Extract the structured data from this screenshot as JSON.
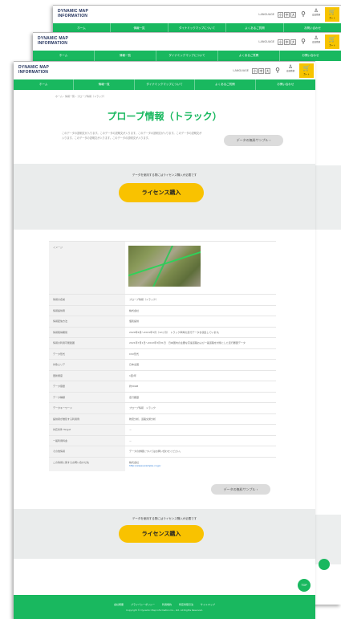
{
  "site": {
    "logo_line1": "DYNAMIC MAP",
    "logo_line2": "INFORMATION",
    "lang": "LANGUAGE",
    "font_sizes": [
      "小",
      "中",
      "大"
    ],
    "account_label": "会員登録",
    "cart_label": "カート",
    "nav": [
      "ホーム",
      "情報一覧",
      "ダイナミックマップについて",
      "よくあるご質問",
      "お問い合わせ"
    ]
  },
  "breadcrumb": "ホーム › 情報一覧 › プローブ情報（トラック）",
  "page_title": "プローブ情報（トラック）",
  "intro": "このデータの説明文が入ります。このデータの説明文が入ります。このデータの説明文が入ります。このデータの説明文が入ります。このデータの説明文が入ります。このデータの説明文が入ります。",
  "sample_button": "データの無料サンプル",
  "license": {
    "note": "データを使用する際にはライセンス購入が必要です",
    "button": "ライセンス購入"
  },
  "details": {
    "image_label": "イメージ",
    "rows": [
      {
        "k": "情報の名前",
        "v": "プローブ情報（トラック）"
      },
      {
        "k": "情報提供者",
        "v": "株式会社"
      },
      {
        "k": "情報配信方法",
        "v": "個別提供"
      },
      {
        "k": "情報取得期間",
        "v": "2020年4月～2021年3月（12ヶ月）　トラック車両の走行データを収集しています。"
      },
      {
        "k": "情報の利用可能範囲",
        "v": "2021年7月1日～2022年3月31日　日本国内の主要な高速道路および一般道路を対象とした走行履歴データ"
      },
      {
        "k": "データ形式",
        "v": "CSV形式"
      },
      {
        "k": "対象エリア",
        "v": "日本全国"
      },
      {
        "k": "更新頻度",
        "v": "1回/年"
      },
      {
        "k": "データ容量",
        "v": "約50GB"
      },
      {
        "k": "データ種類",
        "v": "走行履歴"
      },
      {
        "k": "データキーワード",
        "v": "プローブ情報　トラック"
      },
      {
        "k": "提供者が推奨する利用例",
        "v": "物流分析、道路交通分析"
      },
      {
        "k": "対応条件 Target",
        "v": "－"
      },
      {
        "k": "一般利用料金",
        "v": "－"
      },
      {
        "k": "その他情報",
        "v": "データの詳細についてはお問い合わせください。"
      },
      {
        "k": "この情報に関するお問い合わせ先",
        "v": "株式会社",
        "link": "http://www.example.co.jp/"
      }
    ],
    "group_tag": "料金"
  },
  "footer": {
    "links": [
      "会社概要",
      "プライバシーポリシー",
      "利用規約",
      "特定商取引法",
      "サイトマップ"
    ],
    "copyright": "Copyright © Dynamic Map Information Co., Ltd. All Rights Reserved."
  },
  "pagetop": "TOP"
}
